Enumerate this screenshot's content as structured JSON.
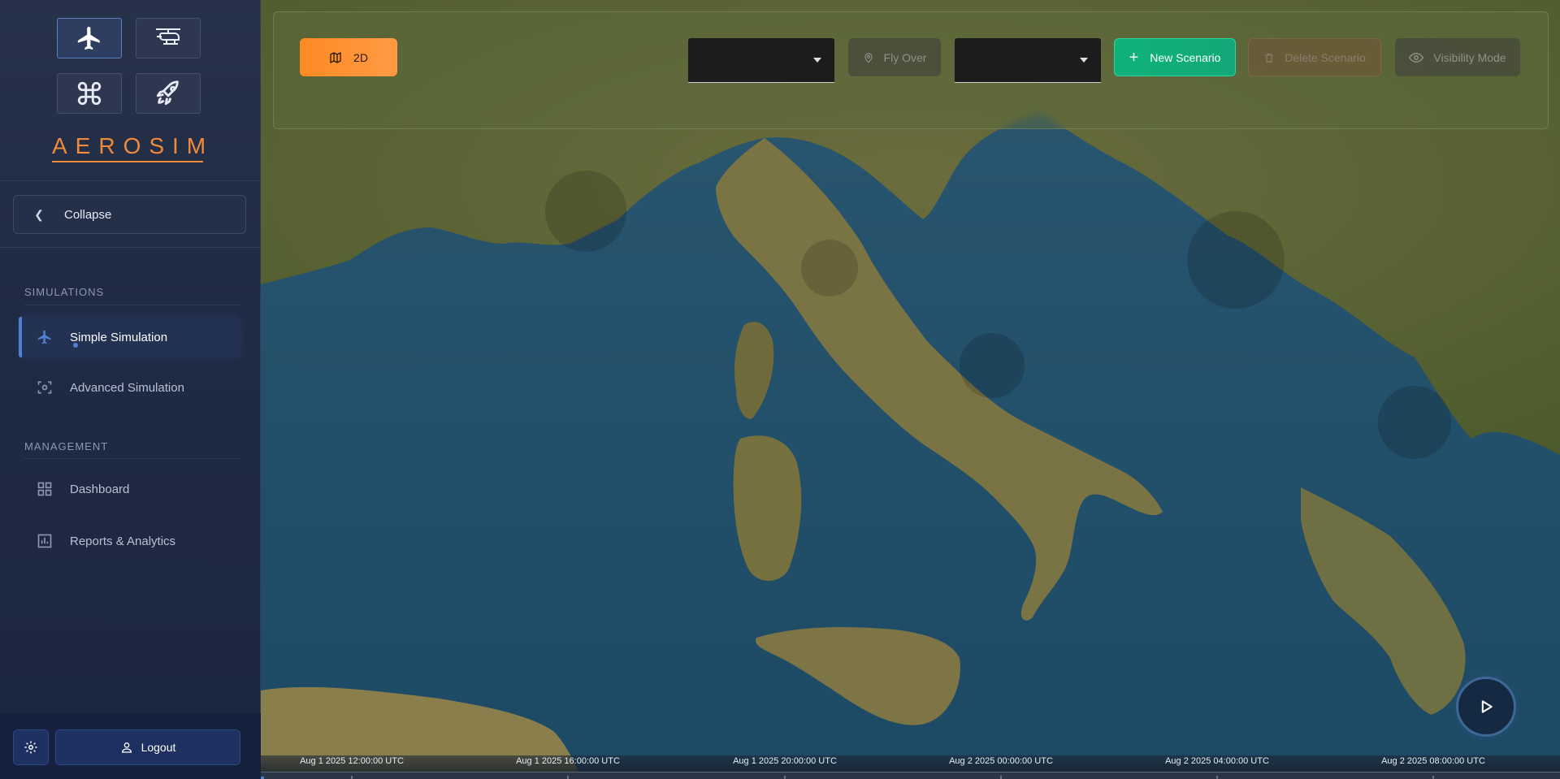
{
  "app": {
    "logo_text": "AEROSIM"
  },
  "vehicle_modes": [
    {
      "name": "airplane",
      "icon": "airplane-icon",
      "active": true
    },
    {
      "name": "helicopter",
      "icon": "helicopter-icon",
      "active": false
    },
    {
      "name": "drone",
      "icon": "drone-icon",
      "active": false
    },
    {
      "name": "rocket",
      "icon": "rocket-icon",
      "active": false
    }
  ],
  "sidebar": {
    "collapse_label": "Collapse",
    "sections": [
      {
        "title": "SIMULATIONS",
        "items": [
          {
            "label": "Simple Simulation",
            "icon": "airplane-icon",
            "active": true
          },
          {
            "label": "Advanced Simulation",
            "icon": "scan-icon",
            "active": false
          }
        ]
      },
      {
        "title": "MANAGEMENT",
        "items": [
          {
            "label": "Dashboard",
            "icon": "dashboard-icon",
            "active": false
          },
          {
            "label": "Reports & Analytics",
            "icon": "chart-icon",
            "active": false
          }
        ]
      }
    ],
    "logout_label": "Logout"
  },
  "toolbar": {
    "view_mode_label": "2D",
    "select_1_value": "",
    "fly_over_label": "Fly Over",
    "select_2_value": "",
    "new_scenario_label": "New Scenario",
    "delete_scenario_label": "Delete Scenario",
    "visibility_mode_label": "Visibility Mode"
  },
  "timeline": {
    "labels": [
      "Aug 1 2025 12:00:00 UTC",
      "Aug 1 2025 16:00:00 UTC",
      "Aug 1 2025 20:00:00 UTC",
      "Aug 2 2025 00:00:00 UTC",
      "Aug 2 2025 04:00:00 UTC",
      "Aug 2 2025 08:00:00 UTC"
    ]
  },
  "colors": {
    "accent_orange": "#ff8a24",
    "accent_green": "#0fb27a",
    "sidebar_bg": "#1f2a44",
    "active_blue": "#4f7fd1"
  }
}
